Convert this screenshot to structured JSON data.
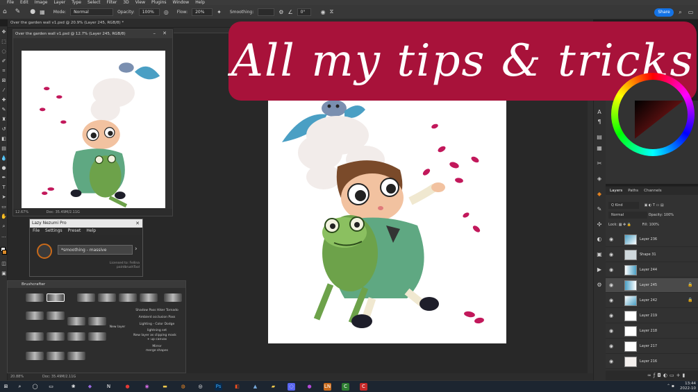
{
  "menu": {
    "items": [
      "File",
      "Edit",
      "Image",
      "Layer",
      "Type",
      "Select",
      "Filter",
      "3D",
      "View",
      "Plugins",
      "Window",
      "Help"
    ]
  },
  "options": {
    "mode_label": "Mode:",
    "mode_value": "Normal",
    "opacity_label": "Opacity:",
    "opacity_value": "100%",
    "flow_label": "Flow:",
    "flow_value": "20%",
    "smoothing_label": "Smoothing:",
    "angle_value": "0°",
    "share_label": "Share"
  },
  "doc": {
    "tab_title": "Over the garden wall v1.psd @ 20.9% (Layer 245, RGB/8) *",
    "status_zoom": "20.88%",
    "status_doc": "Doc: 35.49M/2.11G"
  },
  "float_doc": {
    "title": "Over the garden wall v1.psd @ 12.7% (Layer 245, RGB/8)",
    "zoom": "12.67%",
    "doc": "Doc: 35.49M/2.11G"
  },
  "lazy": {
    "title": "Lazy Nezumi Pro",
    "menu": [
      "File",
      "Settings",
      "Preset",
      "Help"
    ],
    "preset": "*smoothing - massive",
    "licensed_line1": "Licensed to: Fellina",
    "licensed_line2": "paintbrushTool"
  },
  "brushcrafter": {
    "title": "Brushcrafter",
    "notes": {
      "new_layer": "New layer",
      "shadow": "Shadow Pass Hiker Tornado",
      "ambient": "Ambient occlusion Pass",
      "lighting": "Lighting - Color Dodge",
      "lighting_set": "lightning set",
      "clip": "New layer as clipping mask",
      "clip2": "+ up canvas",
      "mirror": "Mirror",
      "merge": "merge shapes"
    }
  },
  "banner": {
    "text": "All my tips & tricks"
  },
  "layers": {
    "tabs": [
      "Layers",
      "Paths",
      "Channels"
    ],
    "kind_label": "Q Kind",
    "blend": "Normal",
    "opacity_label": "Opacity:",
    "opacity": "100%",
    "lock_label": "Lock:",
    "fill_label": "Fill:",
    "fill": "100%",
    "rows": [
      {
        "name": "Layer 236",
        "locked": false
      },
      {
        "name": "Shape 31",
        "locked": false
      },
      {
        "name": "Layer 244",
        "locked": false
      },
      {
        "name": "Layer 245",
        "locked": true
      },
      {
        "name": "Layer 242",
        "locked": true
      },
      {
        "name": "Layer 219",
        "locked": false
      },
      {
        "name": "Layer 218",
        "locked": false
      },
      {
        "name": "Layer 217",
        "locked": false
      },
      {
        "name": "Layer 216",
        "locked": false
      }
    ]
  },
  "taskbar": {
    "time": "13:44",
    "date": "2022-10"
  },
  "colors": {
    "accent": "#1473e6",
    "banner": "#a8123a",
    "candy": "#c2185b"
  }
}
